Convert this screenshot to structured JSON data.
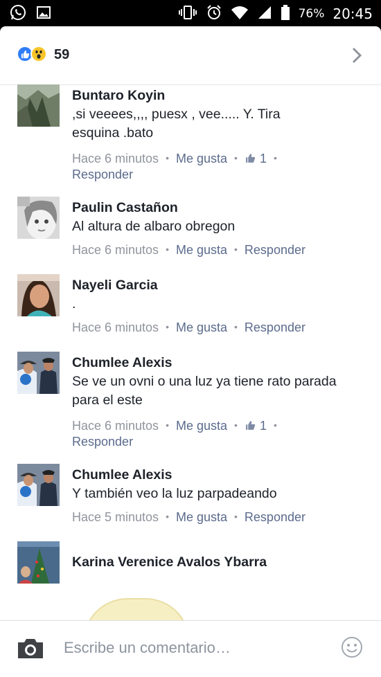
{
  "status_bar": {
    "battery_percent": "76%",
    "time": "20:45"
  },
  "reactions": {
    "count": "59",
    "types": [
      "like",
      "wow"
    ]
  },
  "comments": [
    {
      "name": "Buntaro Koyin",
      "text_lines": [
        ",si veeees,,,, puesx , vee..... Y. Tira",
        "esquina .bato"
      ],
      "time": "Hace 6 minutos",
      "like_label": "Me gusta",
      "like_count": "1",
      "reply_label": "Responder"
    },
    {
      "name": "Paulin Castañon",
      "text_lines": [
        "Al altura de albaro obregon"
      ],
      "time": "Hace 6 minutos",
      "like_label": "Me gusta",
      "reply_label": "Responder"
    },
    {
      "name": "Nayeli Garcia",
      "text_lines": [
        "."
      ],
      "time": "Hace 6 minutos",
      "like_label": "Me gusta",
      "reply_label": "Responder"
    },
    {
      "name": "Chumlee Alexis",
      "text_lines": [
        "Se ve un ovni o una luz ya tiene rato parada",
        "para el este"
      ],
      "time": "Hace 6 minutos",
      "like_label": "Me gusta",
      "like_count": "1",
      "reply_label": "Responder"
    },
    {
      "name": "Chumlee Alexis",
      "text_lines": [
        "Y también veo la luz parpadeando"
      ],
      "time": "Hace 5 minutos",
      "like_label": "Me gusta",
      "reply_label": "Responder"
    },
    {
      "name": "Karina Verenice Avalos Ybarra"
    }
  ],
  "composer": {
    "placeholder": "Escribe un comentario…"
  }
}
